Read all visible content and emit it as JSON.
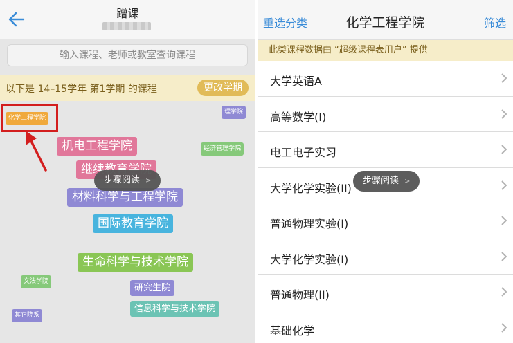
{
  "left": {
    "title": "蹭课",
    "search_placeholder": "输入课程、老师或教室查询课程",
    "term_text": "以下是 14–15学年 第1学期 的课程",
    "change_term_label": "更改学期",
    "tags": {
      "chem_eng": "化学工程学院",
      "science": "理学院",
      "mech_elec": "机电工程学院",
      "econ_mgmt": "经济管理学院",
      "continuing_edu": "继续教育学院",
      "materials": "材料科学与工程学院",
      "intl_edu": "国际教育学院",
      "life_sci": "生命科学与技术学院",
      "humanities_law": "文法学院",
      "graduate": "研究生院",
      "info_sci": "信息科学与技术学院",
      "others": "其它院系"
    },
    "tooltip": "步骤阅读"
  },
  "right": {
    "reselect_label": "重选分类",
    "title": "化学工程学院",
    "filter_label": "筛选",
    "source_text": "此类课程数据由 “超级课程表用户” 提供",
    "courses": [
      "大学英语A",
      "高等数学(I)",
      "电工电子实习",
      "大学化学实验(II)",
      "普通物理实验(I)",
      "大学化学实验(I)",
      "普通物理(II)",
      "基础化学"
    ],
    "tooltip": "步骤阅读"
  },
  "colors": {
    "accent_blue": "#3a8cd8",
    "banner_bg": "#f6edc9",
    "banner_text": "#7a5f1c",
    "change_term_bg": "#e1bb58",
    "highlight_red": "#d31e1e",
    "tag_orange": "#f0a93c",
    "tag_purple": "#8f89d4",
    "tag_pink": "#e1779a",
    "tag_green": "#86c97a",
    "tag_teal": "#6cc3b4",
    "tag_blue": "#48b4de",
    "tag_green_dark": "#8ac655"
  },
  "icons": {
    "back": "back-arrow-icon",
    "chevron": "chevron-right-icon",
    "annotation_arrow": "red-arrow-icon"
  }
}
